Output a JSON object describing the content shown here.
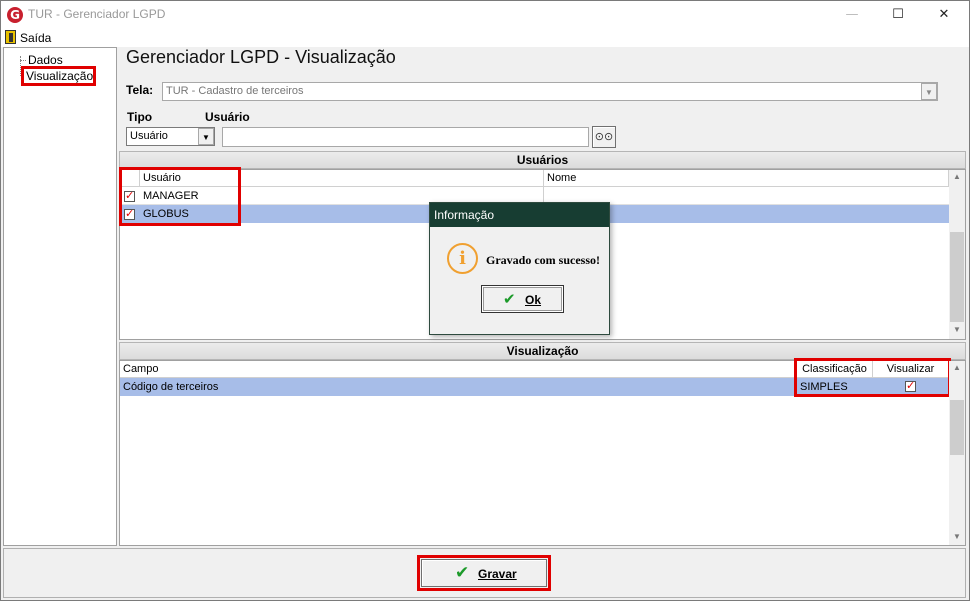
{
  "window": {
    "title": "TUR - Gerenciador LGPD",
    "app_icon_letter": "G",
    "minimize": "—",
    "maximize": "☐",
    "close": "✕"
  },
  "menu": {
    "exit_label": "Saída"
  },
  "tree": {
    "items": [
      "Dados",
      "Visualização"
    ]
  },
  "page": {
    "heading": "Gerenciador LGPD - Visualização",
    "screen_label": "Tela:",
    "screen_value": "TUR - Cadastro de terceiros",
    "type_label": "Tipo",
    "user_label": "Usuário",
    "type_value": "Usuário",
    "user_value": "",
    "binoculars_icon": "binoculars-icon"
  },
  "users_section": {
    "title": "Usuários",
    "columns": [
      "Usuário",
      "Nome"
    ],
    "rows": [
      {
        "checked": true,
        "user": "MANAGER",
        "name": "",
        "selected": false
      },
      {
        "checked": true,
        "user": "GLOBUS",
        "name": "",
        "selected": true
      }
    ]
  },
  "view_section": {
    "title": "Visualização",
    "columns": [
      "Campo",
      "Classificação",
      "Visualizar"
    ],
    "rows": [
      {
        "field": "Código de terceiros",
        "classification": "SIMPLES",
        "view": true,
        "selected": true
      }
    ]
  },
  "save_button": {
    "label": "Gravar"
  },
  "dialog": {
    "title": "Informação",
    "message": "Gravado com sucesso!",
    "ok_label": "Ok",
    "icon": "i"
  },
  "colors": {
    "selection": "#a7bde8",
    "highlight": "#e00000",
    "dialog_title": "#173d32"
  }
}
